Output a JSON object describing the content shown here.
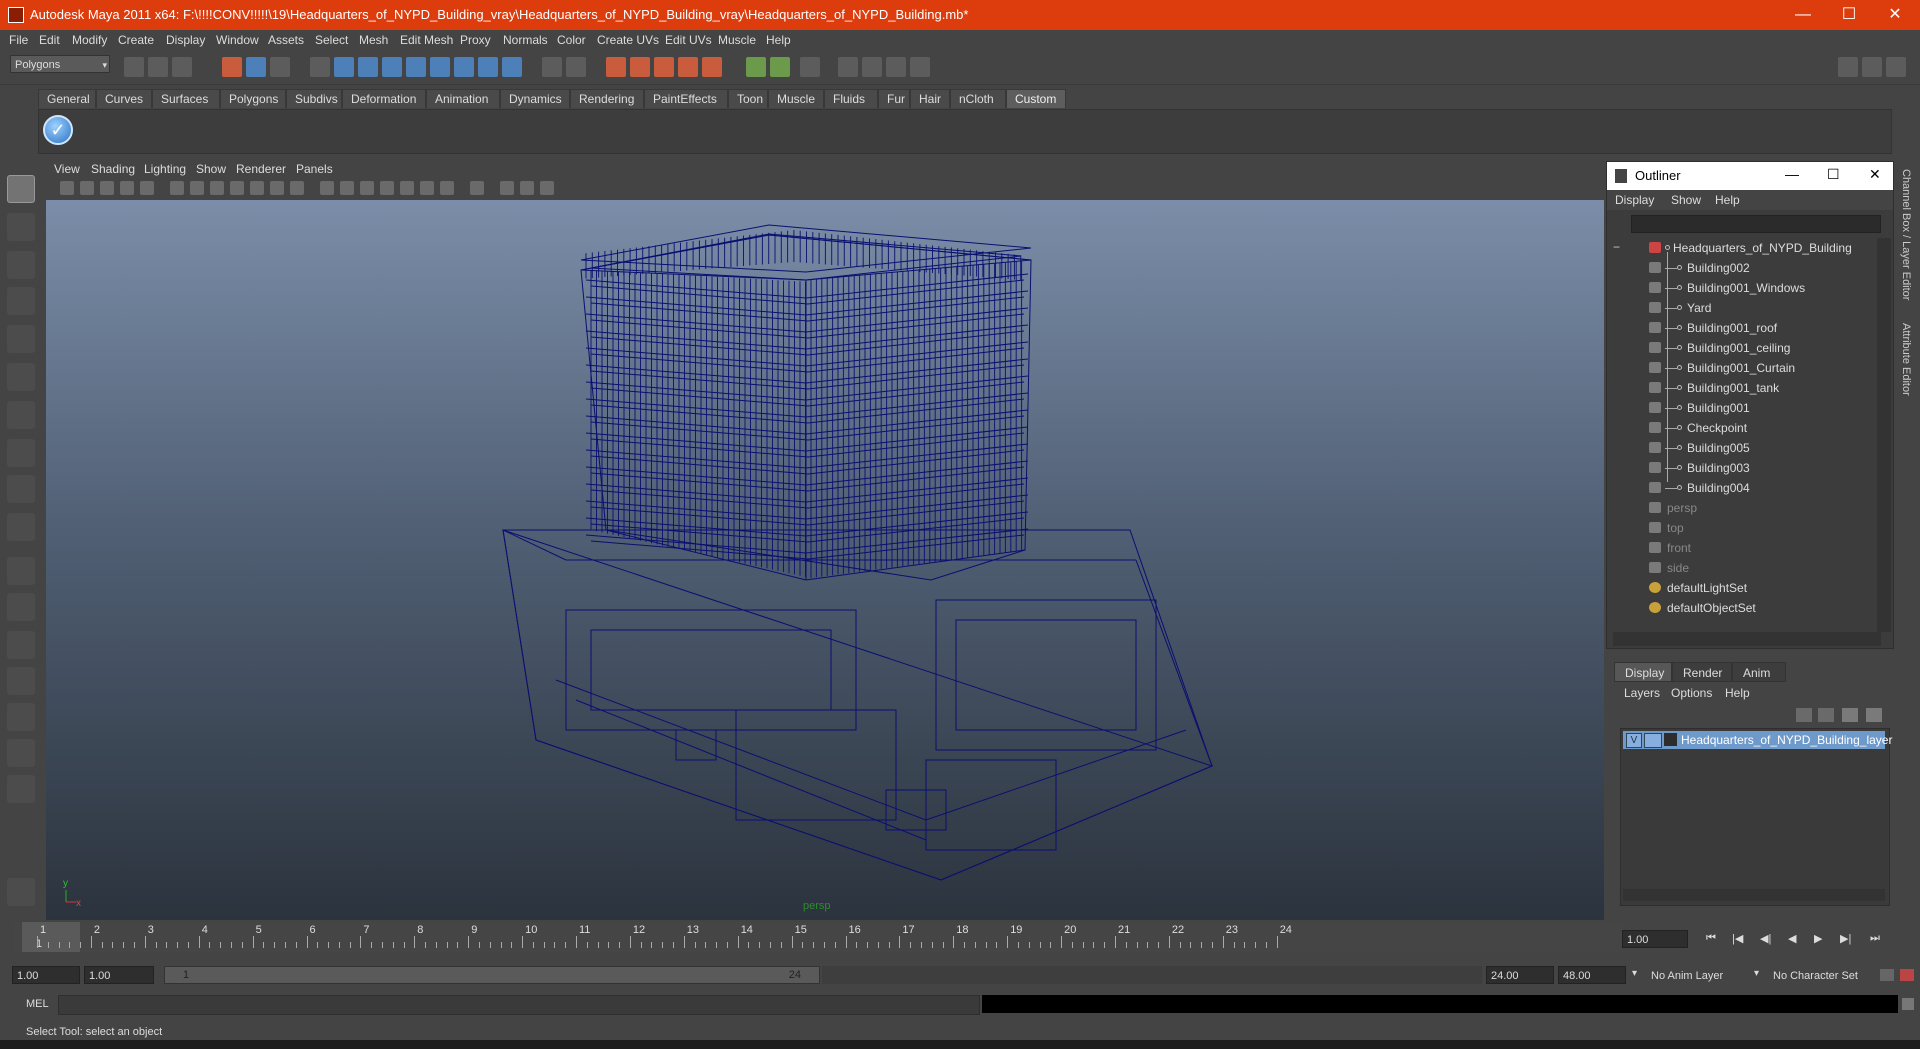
{
  "window": {
    "title": "Autodesk Maya 2011 x64: F:\\!!!!CONV!!!!!\\19\\Headquarters_of_NYPD_Building_vray\\Headquarters_of_NYPD_Building_vray\\Headquarters_of_NYPD_Building.mb*",
    "minimize": "—",
    "maximize": "☐",
    "close": "✕"
  },
  "menubar": [
    "File",
    "Edit",
    "Modify",
    "Create",
    "Display",
    "Window",
    "Assets",
    "Select",
    "Mesh",
    "Edit Mesh",
    "Proxy",
    "Normals",
    "Color",
    "Create UVs",
    "Edit UVs",
    "Muscle",
    "Help"
  ],
  "status_line": {
    "mode": "Polygons",
    "mode_arrow": "▾"
  },
  "shelf": {
    "tabs": [
      "General",
      "Curves",
      "Surfaces",
      "Polygons",
      "Subdivs",
      "Deformation",
      "Animation",
      "Dynamics",
      "Rendering",
      "PaintEffects",
      "Toon",
      "Muscle",
      "Fluids",
      "Fur",
      "Hair",
      "nCloth",
      "Custom"
    ],
    "active_tab": "Custom",
    "icon_glyph": "✓"
  },
  "viewport": {
    "menu": [
      "View",
      "Shading",
      "Lighting",
      "Show",
      "Renderer",
      "Panels"
    ],
    "camera_label": "persp",
    "axis_x": "x",
    "axis_y": "y"
  },
  "outliner": {
    "title": "Outliner",
    "menu": [
      "Display",
      "Show",
      "Help"
    ],
    "collapse": "−",
    "root": "Headquarters_of_NYPD_Building",
    "children": [
      "Building002",
      "Building001_Windows",
      "Yard",
      "Building001_roof",
      "Building001_ceiling",
      "Building001_Curtain",
      "Building001_tank",
      "Building001",
      "Checkpoint",
      "Building005",
      "Building003",
      "Building004"
    ],
    "cameras": [
      "persp",
      "top",
      "front",
      "side"
    ],
    "sets": [
      "defaultLightSet",
      "defaultObjectSet"
    ]
  },
  "layer_editor": {
    "tabs": [
      "Display",
      "Render",
      "Anim"
    ],
    "active_tab": "Display",
    "menu": [
      "Layers",
      "Options",
      "Help"
    ],
    "layer": {
      "visible": "V",
      "name": "Headquarters_of_NYPD_Building_layer"
    }
  },
  "side_tabs": [
    "Channel Box / Layer Editor",
    "Attribute Editor"
  ],
  "time_slider": {
    "ticks": [
      "1",
      "2",
      "3",
      "4",
      "5",
      "6",
      "7",
      "8",
      "9",
      "10",
      "11",
      "12",
      "13",
      "14",
      "15",
      "16",
      "17",
      "18",
      "19",
      "20",
      "21",
      "22",
      "23",
      "24"
    ],
    "current_frame_label": "1",
    "current_frame_field": "1.00"
  },
  "playback_buttons": [
    "⏮",
    "|◀",
    "◀|",
    "◀",
    "▶",
    "▶|",
    "⏭"
  ],
  "range": {
    "start": "1.00",
    "playback_start": "1.00",
    "slider_lo": "1",
    "slider_hi": "24",
    "playback_end": "24.00",
    "end": "48.00",
    "anim_layer": "No Anim Layer",
    "char_set": "No Character Set",
    "dropdown_arrow": "▾"
  },
  "command_line": {
    "label": "MEL"
  },
  "help_line": "Select Tool: select an object",
  "colors": {
    "title_bar": "#dd3c0c",
    "wireframe": "#0b0f70",
    "layer_highlight": "#6d99cb"
  }
}
